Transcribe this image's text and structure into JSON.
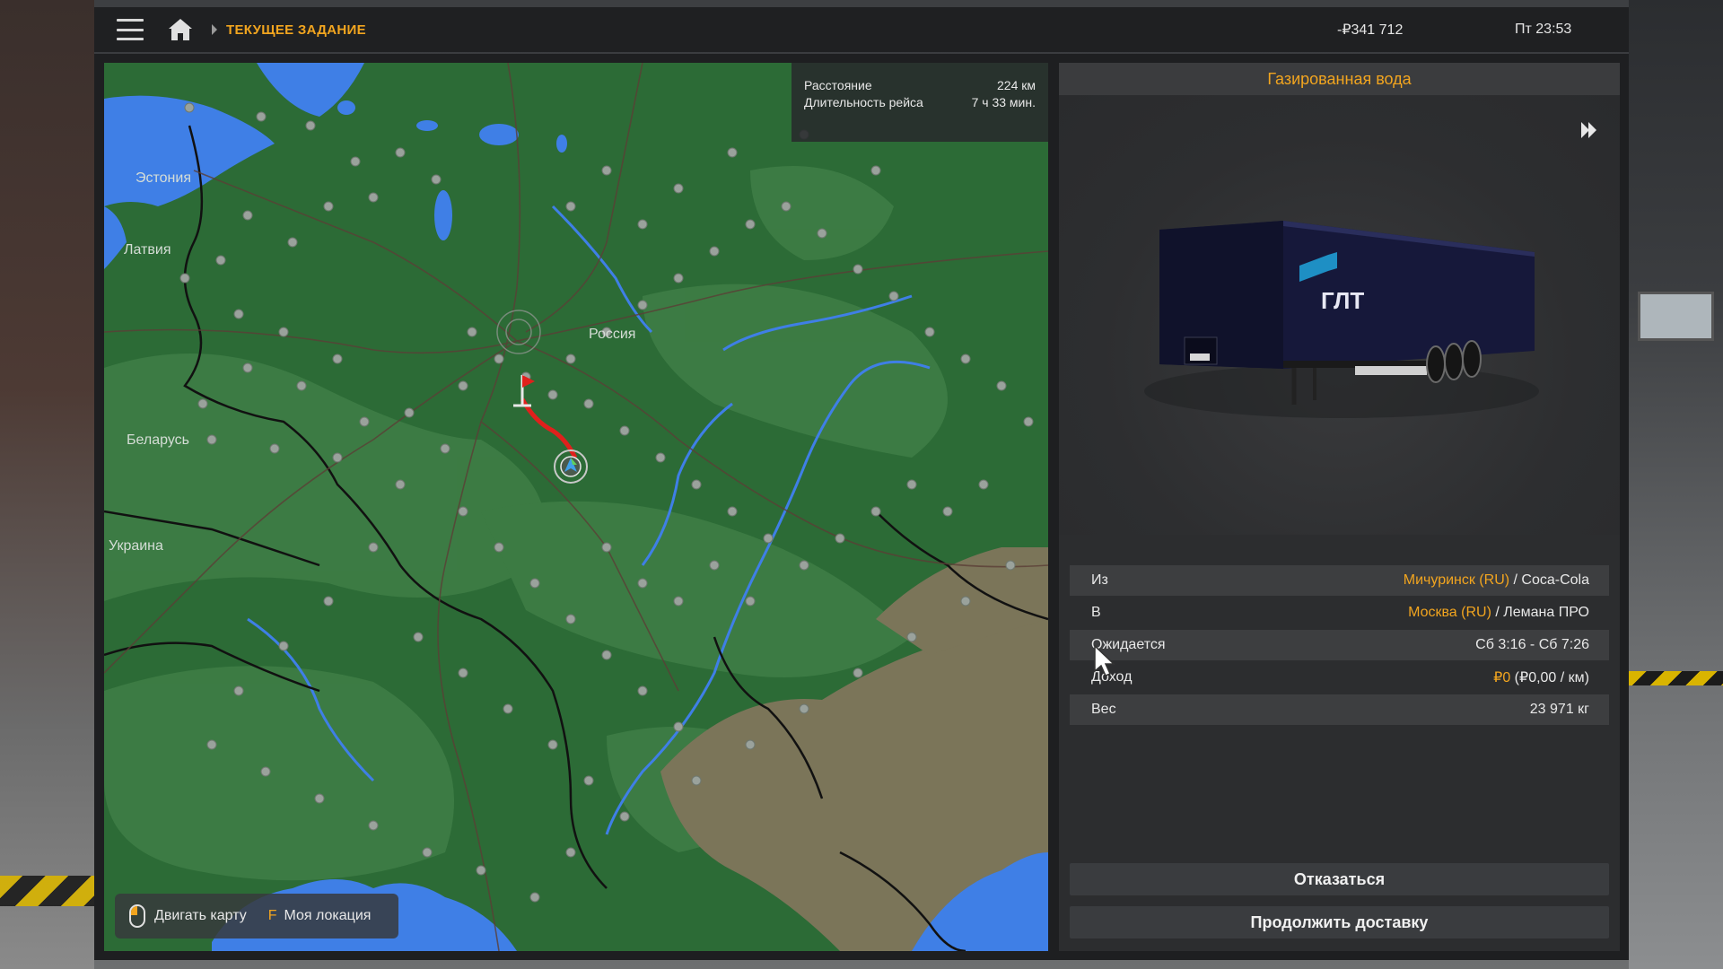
{
  "header": {
    "breadcrumb": "ТЕКУЩЕЕ ЗАДАНИЕ",
    "money": "-₽341 712",
    "clock": "Пт 23:53",
    "menu_icon": "hamburger-icon",
    "home_icon": "home-icon"
  },
  "map": {
    "labels": {
      "estonia": "Эстония",
      "latvia": "Латвия",
      "russia": "Россия",
      "belarus": "Беларусь",
      "ukraine": "Украина"
    },
    "route_info": {
      "distance_label": "Расстояние",
      "distance_value": "224 км",
      "duration_label": "Длительность рейса",
      "duration_value": "7 ч 33 мин."
    },
    "hints": {
      "move_map": "Двигать карту",
      "my_location_key": "F",
      "my_location": "Моя локация"
    }
  },
  "cargo": {
    "title": "Газированная вода",
    "trailer_brand": "ГЛТ",
    "details": {
      "from_label": "Из",
      "from_city": "Мичуринск (RU)",
      "from_company": " / Coca-Cola",
      "to_label": "В",
      "to_city": "Москва (RU)",
      "to_company": " / Лемана ПРО",
      "expected_label": "Ожидается",
      "expected_value": "Сб 3:16 - Сб 7:26",
      "income_label": "Доход",
      "income_value": "₽0",
      "income_rate": " (₽0,00 / км)",
      "weight_label": "Вес",
      "weight_value": "23 971 кг"
    }
  },
  "actions": {
    "decline": "Отказаться",
    "continue": "Продолжить доставку"
  },
  "colors": {
    "accent": "#f2a51f",
    "map_land": "#2c6b36",
    "water": "#3f7fe6",
    "route": "#e0201c"
  }
}
